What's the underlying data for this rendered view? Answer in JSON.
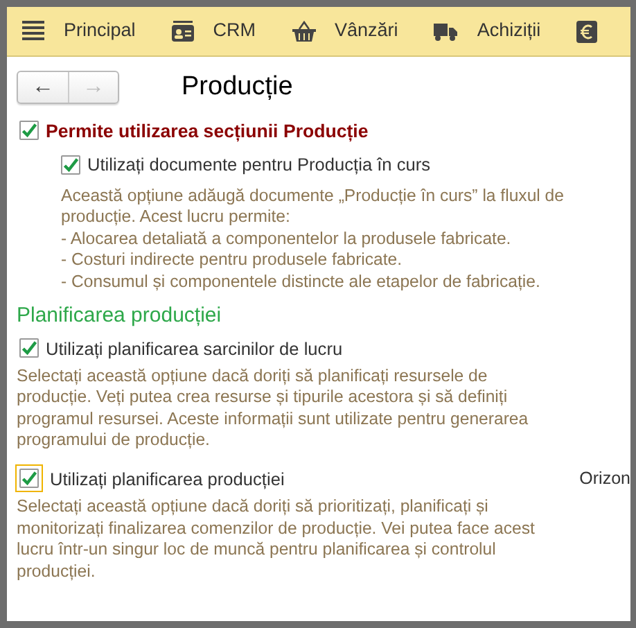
{
  "menu": [
    {
      "label": "Principal"
    },
    {
      "label": "CRM"
    },
    {
      "label": "Vânzări"
    },
    {
      "label": "Achiziții"
    }
  ],
  "nav_buttons": [
    {
      "label": "←",
      "disabled": false
    },
    {
      "label": "→",
      "disabled": true
    }
  ],
  "title": "Producție",
  "main_option": {
    "label": "Permite utilizarea secțiunii Producție",
    "checked": true
  },
  "sub_option": {
    "label": "Utilizați documente pentru Producția în curs",
    "checked": true,
    "description": "Această opțiune adăugă documente „Producție în curs” la fluxul de\nproducție. Acest lucru permite:\n- Alocarea detaliată a componentelor la produsele fabricate.\n- Costuri indirecte pentru produsele fabricate.\n- Consumul și componentele distincte ale etapelor de fabricație."
  },
  "section": {
    "heading": "Planificarea producției",
    "options": [
      {
        "label": "Utilizați planificarea sarcinilor de lucru",
        "checked": true,
        "description": "Selectați această opțiune dacă doriți să planificați resursele de\nproducție. Veți putea crea resurse și tipurile acestora și să definiți\nprogramul resursei. Aceste informații sunt utilizate pentru generarea\nprogramului de producție."
      },
      {
        "label": "Utilizați planificarea producției",
        "checked": true,
        "focused": true,
        "side_text": "Orizon",
        "description": "Selectați această opțiune dacă doriți să prioritizați, planificați și\nmonitorizați finalizarea comenzilor de producție. Vei putea face acest\nlucru într-un singur loc de muncă pentru planificarea și controlul\nproducției."
      }
    ]
  }
}
